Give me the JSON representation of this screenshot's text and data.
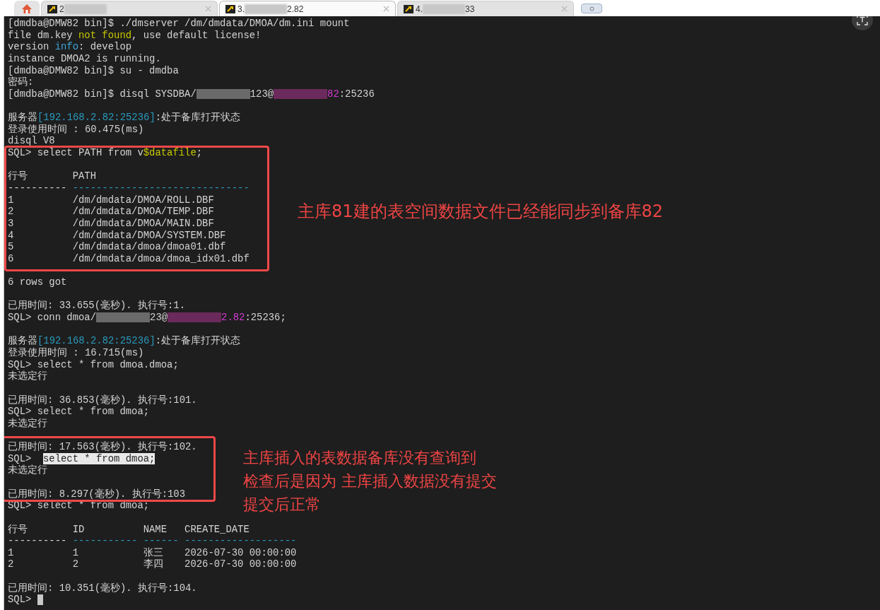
{
  "tabs": [
    {
      "kind": "home",
      "selected": false
    },
    {
      "kind": "session",
      "selected": false,
      "parts": [
        {
          "kind": "text",
          "text": "2"
        },
        {
          "kind": "redacted"
        }
      ]
    },
    {
      "kind": "session",
      "selected": true,
      "parts": [
        {
          "kind": "text",
          "text": "3."
        },
        {
          "kind": "redacted"
        },
        {
          "kind": "text",
          "text": "2.82"
        }
      ]
    },
    {
      "kind": "session",
      "selected": false,
      "parts": [
        {
          "kind": "text",
          "text": "4."
        },
        {
          "kind": "redacted"
        },
        {
          "kind": "text",
          "text": "33"
        }
      ]
    },
    {
      "kind": "new"
    }
  ],
  "terminal": {
    "lines": [
      {
        "kind": "text",
        "segments": [
          {
            "text": "[dmdba@DMW82 bin]$ ./dmserver /dm/dmdata/DMOA/dm.ini mount",
            "color": "#d4d4d4"
          }
        ]
      },
      {
        "kind": "text",
        "segments": [
          {
            "text": "file dm.key ",
            "color": "#d4d4d4"
          },
          {
            "text": "not found",
            "color": "#c8c800"
          },
          {
            "text": ", use default license!",
            "color": "#d4d4d4"
          }
        ]
      },
      {
        "kind": "text",
        "segments": [
          {
            "text": "version ",
            "color": "#d4d4d4"
          },
          {
            "text": "info",
            "color": "#3ea6d8"
          },
          {
            "text": ": develop",
            "color": "#d4d4d4"
          }
        ]
      },
      {
        "kind": "text",
        "segments": [
          {
            "text": "instance DMOA2 is running.",
            "color": "#d4d4d4"
          }
        ]
      },
      {
        "kind": "text",
        "segments": [
          {
            "text": "[dmdba@DMW82 bin]$ su - dmdba",
            "color": "#d4d4d4"
          }
        ]
      },
      {
        "kind": "text",
        "segments": [
          {
            "text": "密码:",
            "color": "#d4d4d4"
          }
        ]
      },
      {
        "kind": "text",
        "segments": [
          {
            "text": "[dmdba@DMW82 bin]$ disql SYSDBA/",
            "color": "#d4d4d4"
          },
          {
            "kind": "redacted",
            "color": "#6a6a6a"
          },
          {
            "text": "123@",
            "color": "#d4d4d4"
          },
          {
            "kind": "redacted",
            "color": "#6b2a5c"
          },
          {
            "text": "82",
            "color": "#d63bd6"
          },
          {
            "text": ":25236",
            "color": "#d4d4d4"
          }
        ]
      },
      {
        "kind": "blank"
      },
      {
        "kind": "text",
        "segments": [
          {
            "text": "服务器",
            "color": "#d4d4d4"
          },
          {
            "text": "[192.168.2.82:25236]",
            "color": "#2a9bbf"
          },
          {
            "text": ":处于备库打开状态",
            "color": "#d4d4d4"
          }
        ]
      },
      {
        "kind": "text",
        "segments": [
          {
            "text": "登录使用时间 : 60.475(ms)",
            "color": "#d4d4d4"
          }
        ]
      },
      {
        "kind": "text",
        "segments": [
          {
            "text": "disql V8",
            "color": "#d4d4d4"
          }
        ]
      },
      {
        "kind": "text",
        "segments": [
          {
            "text": "SQL> select PATH from v",
            "color": "#d4d4d4"
          },
          {
            "text": "$datafile",
            "color": "#c8c800"
          },
          {
            "text": ";"
          }
        ]
      },
      {
        "kind": "blank"
      },
      {
        "kind": "row",
        "cells": [
          "行号",
          "PATH"
        ]
      },
      {
        "kind": "rule",
        "cells": [
          {
            "text": "----------",
            "color": "#d4d4d4"
          },
          {
            "text": "------------------------------",
            "color": "#2a9bbf"
          }
        ]
      },
      {
        "kind": "row",
        "cells": [
          "1",
          "/dm/dmdata/DMOA/ROLL.DBF"
        ]
      },
      {
        "kind": "row",
        "cells": [
          "2",
          "/dm/dmdata/DMOA/TEMP.DBF"
        ]
      },
      {
        "kind": "row",
        "cells": [
          "3",
          "/dm/dmdata/DMOA/MAIN.DBF"
        ]
      },
      {
        "kind": "row",
        "cells": [
          "4",
          "/dm/dmdata/DMOA/SYSTEM.DBF"
        ]
      },
      {
        "kind": "row",
        "cells": [
          "5",
          "/dm/dmdata/dmoa/dmoa01.dbf"
        ]
      },
      {
        "kind": "row",
        "cells": [
          "6",
          "/dm/dmdata/dmoa/dmoa_idx01.dbf"
        ]
      },
      {
        "kind": "blank"
      },
      {
        "kind": "text",
        "segments": [
          {
            "text": "6 rows got",
            "color": "#d4d4d4"
          }
        ]
      },
      {
        "kind": "blank"
      },
      {
        "kind": "text",
        "segments": [
          {
            "text": "已用时间: 33.655(毫秒). 执行号:1.",
            "color": "#d4d4d4"
          }
        ]
      },
      {
        "kind": "text",
        "segments": [
          {
            "text": "SQL> conn dmoa/",
            "color": "#d4d4d4"
          },
          {
            "kind": "redacted",
            "color": "#6a6a6a"
          },
          {
            "text": "23@",
            "color": "#d4d4d4"
          },
          {
            "kind": "redacted",
            "color": "#6b2a5c"
          },
          {
            "text": "2.82",
            "color": "#d63bd6"
          },
          {
            "text": ":25236;",
            "color": "#d4d4d4"
          }
        ]
      },
      {
        "kind": "blank"
      },
      {
        "kind": "text",
        "segments": [
          {
            "text": "服务器",
            "color": "#d4d4d4"
          },
          {
            "text": "[192.168.2.82:25236]",
            "color": "#2a9bbf"
          },
          {
            "text": ":处于备库打开状态",
            "color": "#d4d4d4"
          }
        ]
      },
      {
        "kind": "text",
        "segments": [
          {
            "text": "登录使用时间 : 16.715(ms)",
            "color": "#d4d4d4"
          }
        ]
      },
      {
        "kind": "text",
        "segments": [
          {
            "text": "SQL> select * from dmoa.dmoa;",
            "color": "#d4d4d4"
          }
        ]
      },
      {
        "kind": "text",
        "segments": [
          {
            "text": "未选定行",
            "color": "#d4d4d4"
          }
        ]
      },
      {
        "kind": "blank"
      },
      {
        "kind": "text",
        "segments": [
          {
            "text": "已用时间: 36.853(毫秒). 执行号:101.",
            "color": "#d4d4d4"
          }
        ]
      },
      {
        "kind": "text",
        "segments": [
          {
            "text": "SQL> select * from dmoa;",
            "color": "#d4d4d4"
          }
        ]
      },
      {
        "kind": "text",
        "segments": [
          {
            "text": "未选定行",
            "color": "#d4d4d4"
          }
        ]
      },
      {
        "kind": "blank"
      },
      {
        "kind": "text",
        "segments": [
          {
            "text": "已用时间: 17.563(毫秒). 执行号:102.",
            "color": "#d4d4d4"
          }
        ]
      },
      {
        "kind": "text",
        "segments": [
          {
            "text": "SQL>  ",
            "color": "#d4d4d4"
          },
          {
            "text": "select * from dmoa;",
            "color": "#1e1e1e",
            "selected": true
          }
        ]
      },
      {
        "kind": "text",
        "segments": [
          {
            "text": "未选定行",
            "color": "#d4d4d4"
          }
        ]
      },
      {
        "kind": "blank"
      },
      {
        "kind": "text",
        "segments": [
          {
            "text": "已用时间: 8.297(毫秒). 执行号:103",
            "color": "#d4d4d4"
          }
        ]
      },
      {
        "kind": "text",
        "segments": [
          {
            "text": "SQL> select * from dmoa;",
            "color": "#d4d4d4"
          }
        ]
      },
      {
        "kind": "blank"
      },
      {
        "kind": "row",
        "cells": [
          "行号",
          "ID",
          "NAME",
          "CREATE_DATE"
        ]
      },
      {
        "kind": "rule",
        "cells": [
          {
            "text": "----------",
            "color": "#d4d4d4"
          },
          {
            "text": "-----------",
            "color": "#2a9bbf"
          },
          {
            "text": "------",
            "color": "#2a9bbf"
          },
          {
            "text": "-------------------",
            "color": "#2a9bbf"
          }
        ]
      },
      {
        "kind": "row",
        "cells": [
          "1",
          "1",
          "张三",
          "2026-07-30 00:00:00"
        ]
      },
      {
        "kind": "row",
        "cells": [
          "2",
          "2",
          "李四",
          "2026-07-30 00:00:00"
        ]
      },
      {
        "kind": "blank"
      },
      {
        "kind": "text",
        "segments": [
          {
            "text": "已用时间: 10.351(毫秒). 执行号:104.",
            "color": "#d4d4d4"
          }
        ]
      },
      {
        "kind": "prompt",
        "text": "SQL>",
        "cursor": true
      }
    ]
  },
  "annotations": [
    {
      "kind": "top",
      "lines": [
        "主库81建的表空间数据文件已经能同步到备库82"
      ]
    },
    {
      "kind": "bottom",
      "lines": [
        "主库插入的表数据备库没有查询到",
        "检查后是因为 主库插入数据没有提交",
        "提交后正常"
      ]
    }
  ]
}
